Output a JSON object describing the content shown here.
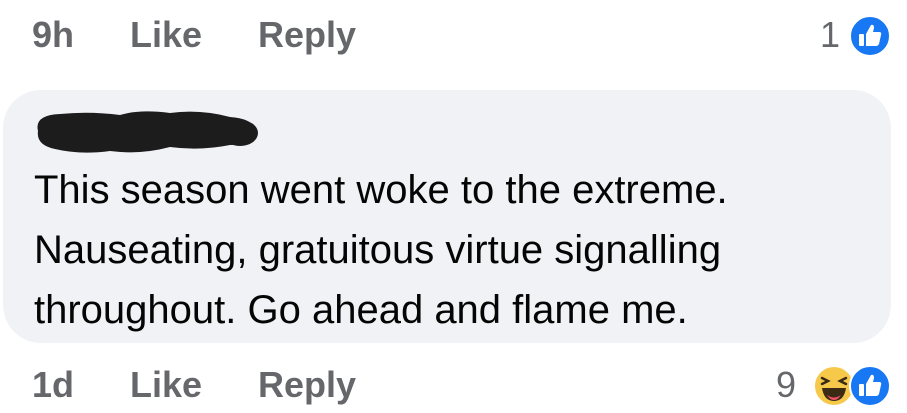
{
  "top_row": {
    "time": "9h",
    "like_label": "Like",
    "reply_label": "Reply",
    "reaction_count": "1",
    "reaction_icons": [
      "like-icon"
    ]
  },
  "comment": {
    "author": "",
    "text": "This season went woke to the extreme.\nNauseating, gratuitous virtue signalling\nthroughout. Go ahead and flame me."
  },
  "bottom_row": {
    "time": "1d",
    "like_label": "Like",
    "reply_label": "Reply",
    "reaction_count": "9",
    "reaction_icons": [
      "haha-icon",
      "like-icon"
    ]
  },
  "colors": {
    "bubble": "#f0f2f5",
    "meta_text": "#65676b",
    "like_blue": "#1877f2",
    "haha_yellow": "#f7c94a"
  }
}
